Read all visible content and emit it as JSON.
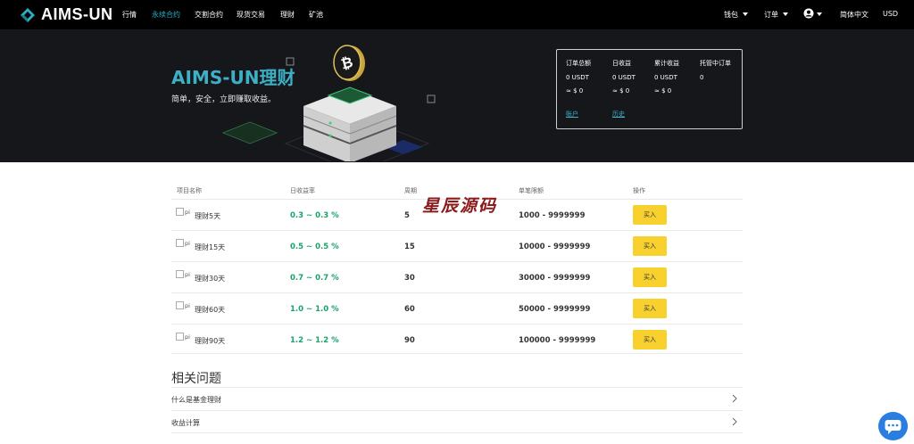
{
  "nav": {
    "brand": "AIMS-UN",
    "items": [
      "行情",
      "永续合约",
      "交割合约",
      "现货交易",
      "理财",
      "矿池"
    ],
    "active_item": "永续合约",
    "right": {
      "wallet": "钱包",
      "orders": "订单",
      "language": "简体中文",
      "currency": "USD"
    }
  },
  "hero": {
    "title": "AIMS-UN理财",
    "subtitle": "简单，安全，立即赚取收益。",
    "stats": {
      "headers": [
        "订单总额",
        "日收益",
        "累计收益",
        "托管中订单"
      ],
      "usdt_values": [
        "0 USDT",
        "0 USDT",
        "0 USDT",
        "0"
      ],
      "fiat_values": [
        "≈ $ 0",
        "≈ $ 0",
        "≈ $ 0"
      ],
      "links": [
        "账户",
        "历史"
      ]
    }
  },
  "table": {
    "headers": [
      "项目名称",
      "日收益率",
      "周期",
      "单笔限额",
      "操作"
    ],
    "img_alt": "pi",
    "buy_label": "买入",
    "rows": [
      {
        "name": "理财5天",
        "rate": "0.3 ~ 0.3 %",
        "period": "5",
        "limit": "1000 - 9999999"
      },
      {
        "name": "理财15天",
        "rate": "0.5 ~ 0.5 %",
        "period": "15",
        "limit": "10000 - 9999999"
      },
      {
        "name": "理财30天",
        "rate": "0.7 ~ 0.7 %",
        "period": "30",
        "limit": "30000 - 9999999"
      },
      {
        "name": "理财60天",
        "rate": "1.0 ~ 1.0 %",
        "period": "60",
        "limit": "50000 - 9999999"
      },
      {
        "name": "理财90天",
        "rate": "1.2 ~ 1.2 %",
        "period": "90",
        "limit": "100000 - 9999999"
      }
    ]
  },
  "watermark": "星辰源码",
  "faq": {
    "title": "相关问题",
    "items": [
      "什么是基金理财",
      "收益计算"
    ]
  },
  "icons": {
    "brand_logo": "diamond-logo-icon",
    "user": "user-circle-icon",
    "chat": "chat-bubble-icon",
    "chevron": "chevron-right-icon"
  },
  "colors": {
    "accent": "#2ab0c6",
    "rate_green": "#1aa36a",
    "buy_yellow": "#f8d12f",
    "watermark": "#8b1a1a"
  }
}
